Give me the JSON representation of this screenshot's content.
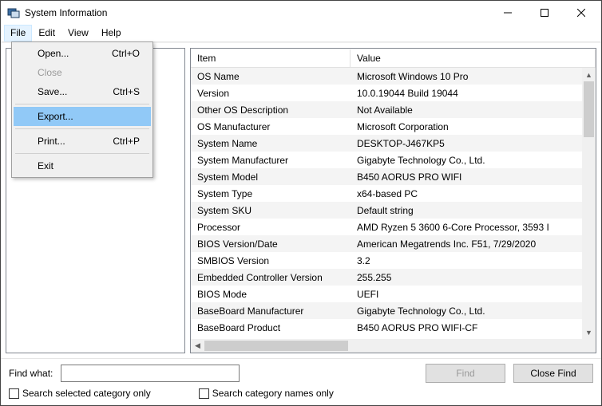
{
  "window": {
    "title": "System Information"
  },
  "menubar": {
    "file": "File",
    "edit": "Edit",
    "view": "View",
    "help": "Help"
  },
  "file_menu": {
    "open": "Open...",
    "open_shortcut": "Ctrl+O",
    "close": "Close",
    "save": "Save...",
    "save_shortcut": "Ctrl+S",
    "export": "Export...",
    "print": "Print...",
    "print_shortcut": "Ctrl+P",
    "exit": "Exit"
  },
  "columns": {
    "item": "Item",
    "value": "Value"
  },
  "rows": [
    {
      "item": "OS Name",
      "value": "Microsoft Windows 10 Pro"
    },
    {
      "item": "Version",
      "value": "10.0.19044 Build 19044"
    },
    {
      "item": "Other OS Description",
      "value": "Not Available"
    },
    {
      "item": "OS Manufacturer",
      "value": "Microsoft Corporation"
    },
    {
      "item": "System Name",
      "value": "DESKTOP-J467KP5"
    },
    {
      "item": "System Manufacturer",
      "value": "Gigabyte Technology Co., Ltd."
    },
    {
      "item": "System Model",
      "value": "B450 AORUS PRO WIFI"
    },
    {
      "item": "System Type",
      "value": "x64-based PC"
    },
    {
      "item": "System SKU",
      "value": "Default string"
    },
    {
      "item": "Processor",
      "value": "AMD Ryzen 5 3600 6-Core Processor, 3593 I"
    },
    {
      "item": "BIOS Version/Date",
      "value": "American Megatrends Inc. F51, 7/29/2020"
    },
    {
      "item": "SMBIOS Version",
      "value": "3.2"
    },
    {
      "item": "Embedded Controller Version",
      "value": "255.255"
    },
    {
      "item": "BIOS Mode",
      "value": "UEFI"
    },
    {
      "item": "BaseBoard Manufacturer",
      "value": "Gigabyte Technology Co., Ltd."
    },
    {
      "item": "BaseBoard Product",
      "value": "B450 AORUS PRO WIFI-CF"
    }
  ],
  "find": {
    "label": "Find what:",
    "value": "",
    "find_btn": "Find",
    "close_btn": "Close Find",
    "cb_selected": "Search selected category only",
    "cb_names": "Search category names only"
  }
}
